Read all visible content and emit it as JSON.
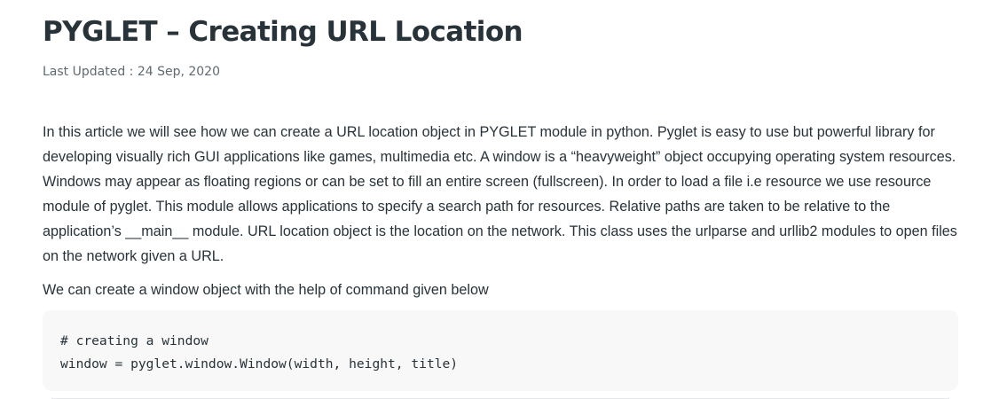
{
  "article": {
    "title": "PYGLET – Creating URL Location",
    "last_updated": "Last Updated : 24 Sep, 2020",
    "paragraph": "In this article we will see how we can create a URL location object in PYGLET module in python. Pyglet is easy to use but powerful library for developing visually rich GUI applications like games, multimedia etc. A window is a “heavyweight” object occupying operating system resources. Windows may appear as floating regions or can be set to fill an entire screen (fullscreen). In order to load a file i.e resource we use resource module of pyglet. This module allows applications to specify a search path for resources. Relative paths are taken to be relative to the application’s __main__ module. URL location object is the location on the network. This class uses the urlparse and urllib2 modules to open files on the network given a URL.",
    "code_intro": "We can create a window object with the help of command given below",
    "code_lines": [
      "# creating a window",
      "window = pyglet.window.Window(width, height, title)"
    ]
  }
}
